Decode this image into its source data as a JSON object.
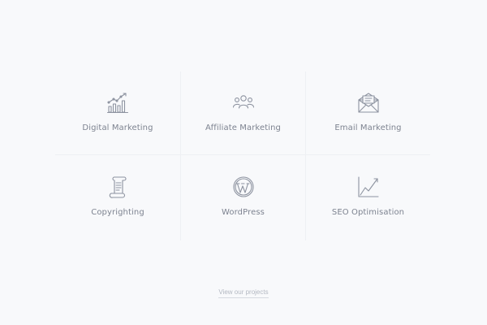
{
  "services": [
    {
      "label": "Digital Marketing",
      "icon": "bar-chart-growth-icon"
    },
    {
      "label": "Affiliate Marketing",
      "icon": "people-group-icon"
    },
    {
      "label": "Email Marketing",
      "icon": "envelope-open-icon"
    },
    {
      "label": "Copyrighting",
      "icon": "scroll-document-icon"
    },
    {
      "label": "WordPress",
      "icon": "wordpress-logo-icon"
    },
    {
      "label": "SEO Optimisation",
      "icon": "line-chart-trend-icon"
    }
  ],
  "footer": {
    "link_label": "View our projects"
  },
  "colors": {
    "background": "#f8f9fb",
    "icon_stroke": "#8d93a0",
    "label_text": "#7d8390",
    "divider": "#eef0f3",
    "link_text": "#b3b8c2"
  }
}
